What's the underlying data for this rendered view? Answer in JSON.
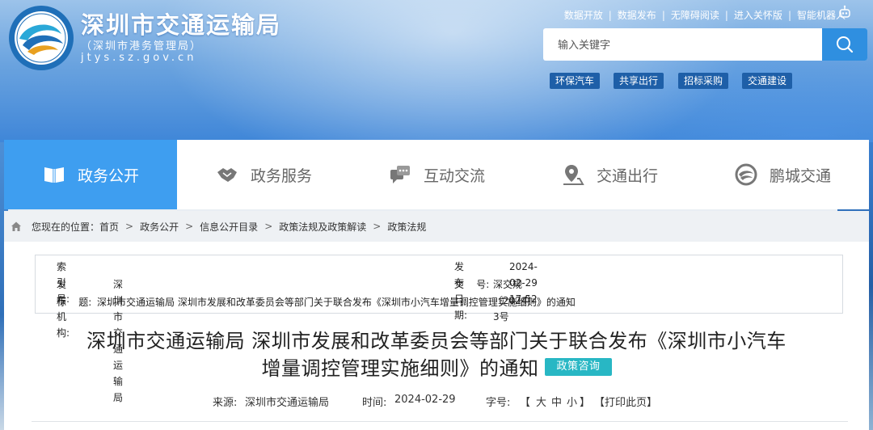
{
  "header": {
    "title": "深圳市交通运输局",
    "subtitle": "（深圳市港务管理局）",
    "domain": "jtys.sz.gov.cn",
    "top_links": [
      "数据开放",
      "数据发布",
      "无障碍阅读",
      "进入关怀版",
      "智能机器人"
    ]
  },
  "search": {
    "placeholder": "输入关键字"
  },
  "hot_tags": [
    "环保汽车",
    "共享出行",
    "招标采购",
    "交通建设"
  ],
  "nav": [
    {
      "label": "政务公开",
      "icon": "book-icon"
    },
    {
      "label": "政务服务",
      "icon": "handshake-icon"
    },
    {
      "label": "互动交流",
      "icon": "chat-icon"
    },
    {
      "label": "交通出行",
      "icon": "location-icon"
    },
    {
      "label": "鹏城交通",
      "icon": "swirl-logo-icon"
    }
  ],
  "breadcrumb": {
    "prefix": "您现在的位置：",
    "items": [
      "首页",
      "政务公开",
      "信息公开目录",
      "政策法规及政策解读",
      "政策法规"
    ]
  },
  "meta": {
    "index_label": "索 引 号:",
    "index_value": "",
    "date_label": "发布日期:",
    "date_value": "2024-02-29 17:52",
    "org_label": "发布机构:",
    "org_value": "深圳市交通运输局",
    "doc_label": "文    号:",
    "doc_value": "深交规〔2024〕3号",
    "subject_label": "标    题:",
    "subject_value": "深圳市交通运输局 深圳市发展和改革委员会等部门关于联合发布《深圳市小汽车增量调控管理实施细则》的通知"
  },
  "article": {
    "title_line1": "深圳市交通运输局 深圳市发展和改革委员会等部门关于联合发布《深圳市小汽车",
    "title_line2": "增量调控管理实施细则》的通知",
    "badge": "政策咨询",
    "source_label": "来源:",
    "source_value": "深圳市交通运输局",
    "time_label": "时间:",
    "time_value": "2024-02-29",
    "font_label": "字号:",
    "font_open": "【",
    "font_large": "大",
    "font_medium": "中",
    "font_small": "小",
    "font_close": "】",
    "print": "【打印此页】"
  },
  "colors": {
    "accent": "#3e9ef0",
    "badge": "#28b7c4",
    "tag_bg": "#1e5fa8"
  }
}
